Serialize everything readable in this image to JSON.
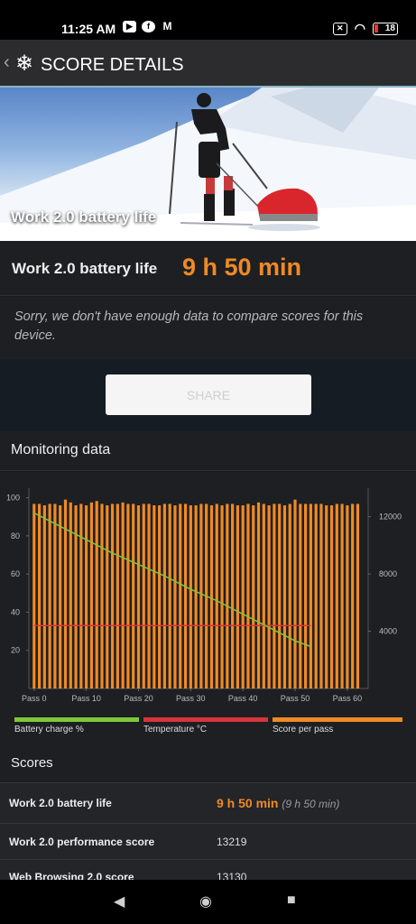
{
  "status_bar": {
    "time": "11:25 AM",
    "battery": "18",
    "apps": [
      "youtube-icon",
      "facebook-icon",
      "gmail-icon"
    ]
  },
  "app_bar": {
    "title": "SCORE DETAILS"
  },
  "hero": {
    "caption": "Work 2.0 battery life",
    "version": "2.0"
  },
  "result": {
    "label": "Work 2.0 battery life",
    "value": "9 h 50 min"
  },
  "note": "Sorry, we don't have enough data to compare scores for this device.",
  "share_label": "SHARE",
  "monitoring": {
    "title": "Monitoring data"
  },
  "chart_data": {
    "type": "bar",
    "x_ticks": [
      "Pass 0",
      "Pass 10",
      "Pass 20",
      "Pass 30",
      "Pass 40",
      "Pass 50",
      "Pass 60"
    ],
    "y_left_ticks": [
      "100",
      "80",
      "60",
      "40",
      "20"
    ],
    "y_right_ticks": [
      "12000",
      "8000",
      "4000"
    ],
    "ylim_left": [
      0,
      105
    ],
    "ylim_right": [
      0,
      14000
    ],
    "xlim": [
      -1,
      64
    ],
    "series": [
      {
        "name": "Battery charge %",
        "color": "#7fc73a",
        "type": "line",
        "axis": "left",
        "x": [
          0,
          5,
          10,
          15,
          20,
          25,
          30,
          35,
          40,
          45,
          50,
          52,
          53
        ],
        "values": [
          92,
          85,
          78,
          71,
          65,
          59,
          52,
          46,
          39,
          32,
          25,
          23,
          22
        ]
      },
      {
        "name": "Temperature °C",
        "color": "#d8343a",
        "type": "line",
        "axis": "left",
        "x": [
          0,
          53
        ],
        "values": [
          33,
          33
        ]
      },
      {
        "name": "Score per pass",
        "color": "#f08a24",
        "type": "bar",
        "axis": "right",
        "values": [
          12900,
          12900,
          12800,
          12900,
          12900,
          12800,
          13200,
          13000,
          12800,
          12900,
          12800,
          13000,
          13100,
          12900,
          12800,
          12900,
          12900,
          13000,
          12900,
          12900,
          12800,
          12900,
          12900,
          12800,
          12800,
          12900,
          12900,
          12800,
          12900,
          12900,
          12800,
          12800,
          12900,
          12900,
          12800,
          12900,
          12800,
          12900,
          12900,
          12800,
          12800,
          12900,
          12800,
          13000,
          12900,
          12800,
          12900,
          12900,
          12800,
          12900,
          13200,
          12900,
          12900,
          12900,
          12900,
          12900,
          12800,
          12800,
          12900,
          12900,
          12800,
          12900,
          12900
        ]
      }
    ]
  },
  "scores": {
    "title": "Scores",
    "rows": [
      {
        "name": "Work 2.0 battery life",
        "value": "9 h 50 min",
        "sub": "(9 h 50 min)"
      },
      {
        "name": "Work 2.0 performance score",
        "value": "13219"
      },
      {
        "name": "Web Browsing 2.0 score",
        "value": "13130"
      }
    ]
  },
  "nav": {
    "back": "◀",
    "home": "◉",
    "recents": "■"
  }
}
